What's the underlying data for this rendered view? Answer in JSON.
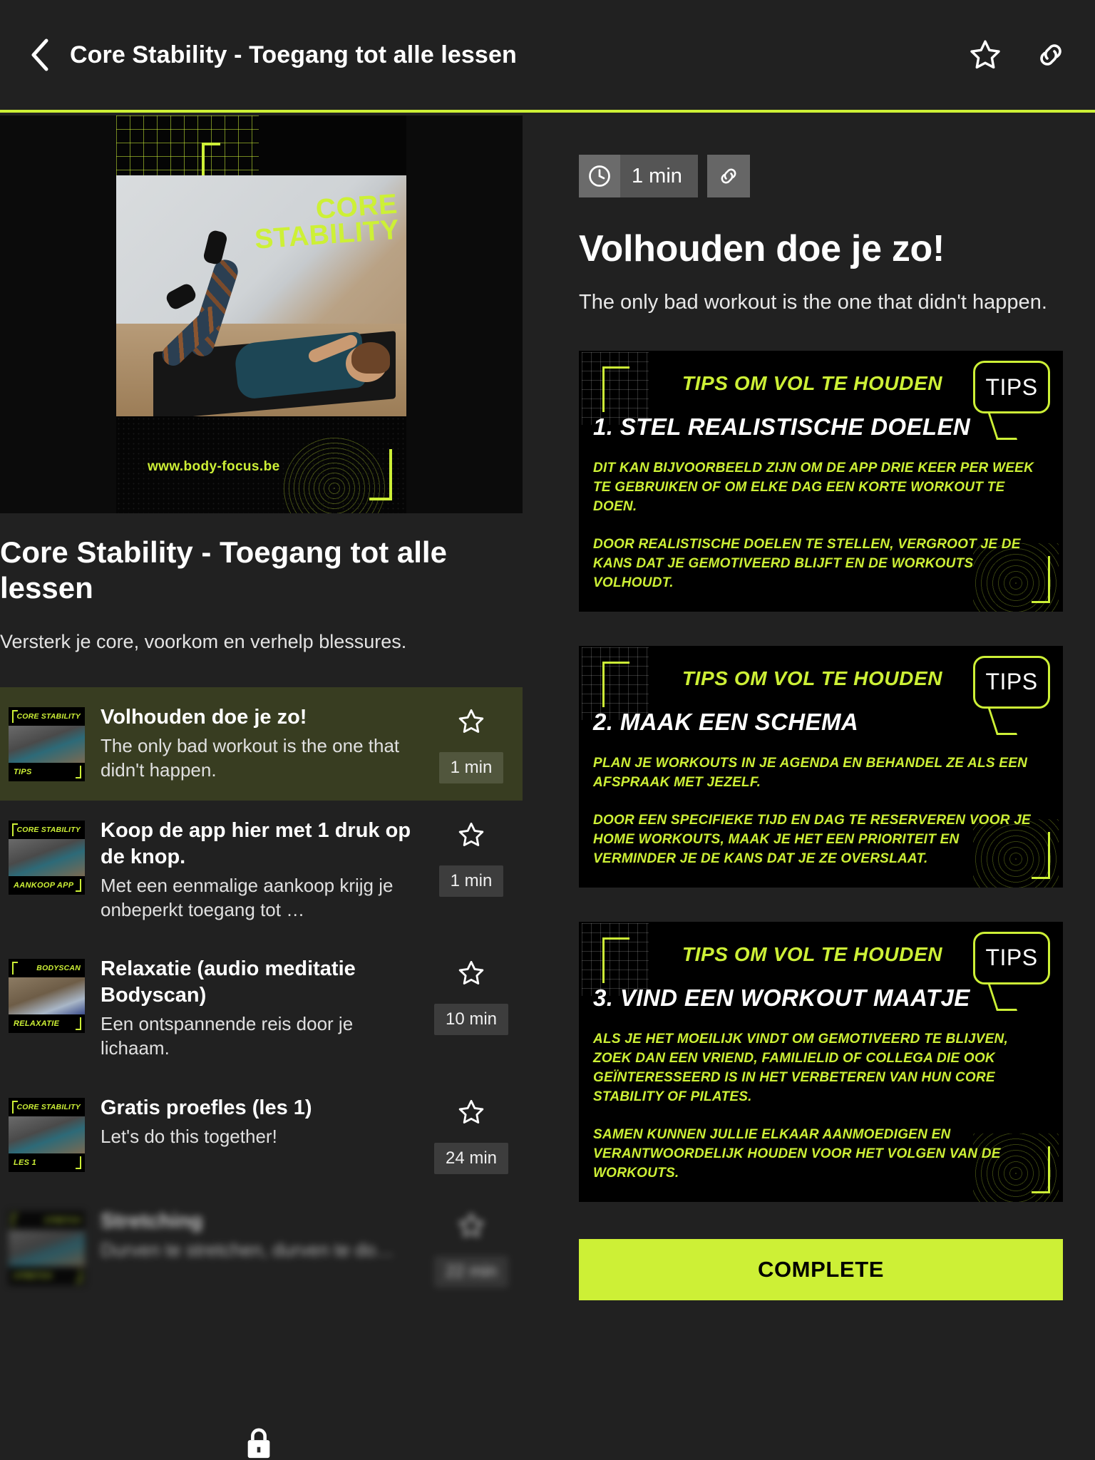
{
  "header": {
    "back_icon": "chevron-left-icon",
    "title": "Core Stability - Toegang tot alle lessen",
    "favorite_icon": "star-outline-icon",
    "share_icon": "link-icon",
    "accent_color": "#cdf036"
  },
  "course": {
    "title": "Core Stability - Toegang tot alle lessen",
    "subtitle": "Versterk je core, voorkom en verhelp blessures.",
    "hero": {
      "title_line1": "CORE",
      "title_line2": "STABILITY",
      "url": "www.body-focus.be"
    }
  },
  "lessons": [
    {
      "title": "Volhouden doe je zo!",
      "description": "The only bad workout is the one that didn't happen.",
      "duration": "1 min",
      "active": true,
      "thumb_top": "CORE STABILITY",
      "thumb_bottom": "TIPS",
      "locked": false
    },
    {
      "title": "Koop de app hier met 1 druk op de knop.",
      "description": "Met een eenmalige aankoop krijg je onbeperkt toegang tot …",
      "duration": "1 min",
      "active": false,
      "thumb_top": "CORE STABILITY",
      "thumb_bottom": "AANKOOP APP",
      "locked": false
    },
    {
      "title": "Relaxatie (audio meditatie Bodyscan)",
      "description": "Een ontspannende reis door je lichaam.",
      "duration": "10 min",
      "active": false,
      "thumb_top": "BODYSCAN",
      "thumb_bottom": "RELAXATIE",
      "locked": false
    },
    {
      "title": "Gratis proefles (les 1)",
      "description": "Let's do this together!",
      "duration": "24 min",
      "active": false,
      "thumb_top": "CORE STABILITY",
      "thumb_bottom": "LES 1",
      "locked": false
    },
    {
      "title": "Stretching",
      "description": "Durven te stretchen, durven te do…",
      "duration": "22 min",
      "active": false,
      "thumb_top": "STRETCH",
      "thumb_bottom": "STRETCH",
      "locked": true
    }
  ],
  "panel": {
    "duration": "1 min",
    "clock_icon": "clock-icon",
    "link_icon": "link-icon",
    "title": "Volhouden doe je zo!",
    "description": "The only bad workout is the one that didn't happen.",
    "complete_label": "COMPLETE"
  },
  "tips": [
    {
      "header": "TIPS OM VOL TE HOUDEN",
      "badge": "TIPS",
      "number_title": "1. STEL REALISTISCHE DOELEN",
      "para1": "DIT KAN BIJVOORBEELD ZIJN OM DE APP DRIE KEER PER WEEK TE GEBRUIKEN OF OM ELKE DAG EEN KORTE WORKOUT TE DOEN.",
      "para2": "DOOR REALISTISCHE DOELEN TE STELLEN, VERGROOT JE DE KANS DAT JE GEMOTIVEERD BLIJFT EN DE WORKOUTS VOLHOUDT."
    },
    {
      "header": "TIPS OM VOL TE HOUDEN",
      "badge": "TIPS",
      "number_title": "2. MAAK EEN SCHEMA",
      "para1": "PLAN JE WORKOUTS IN JE AGENDA EN BEHANDEL ZE ALS EEN AFSPRAAK MET JEZELF.",
      "para2": "DOOR EEN SPECIFIEKE TIJD EN DAG TE RESERVEREN VOOR JE HOME WORKOUTS, MAAK JE HET EEN PRIORITEIT EN VERMINDER JE DE KANS DAT JE ZE OVERSLAAT."
    },
    {
      "header": "TIPS OM VOL TE HOUDEN",
      "badge": "TIPS",
      "number_title": "3. VIND EEN WORKOUT MAATJE",
      "para1": "ALS JE HET MOEILIJK VINDT OM GEMOTIVEERD TE BLIJVEN, ZOEK DAN EEN VRIEND, FAMILIELID OF COLLEGA DIE OOK GEÏNTERESSEERD IS IN HET VERBETEREN VAN HUN CORE STABILITY OF PILATES.",
      "para2": "SAMEN KUNNEN JULLIE ELKAAR AANMOEDIGEN EN VERANTWOORDELIJK HOUDEN VOOR HET VOLGEN VAN DE WORKOUTS."
    }
  ]
}
